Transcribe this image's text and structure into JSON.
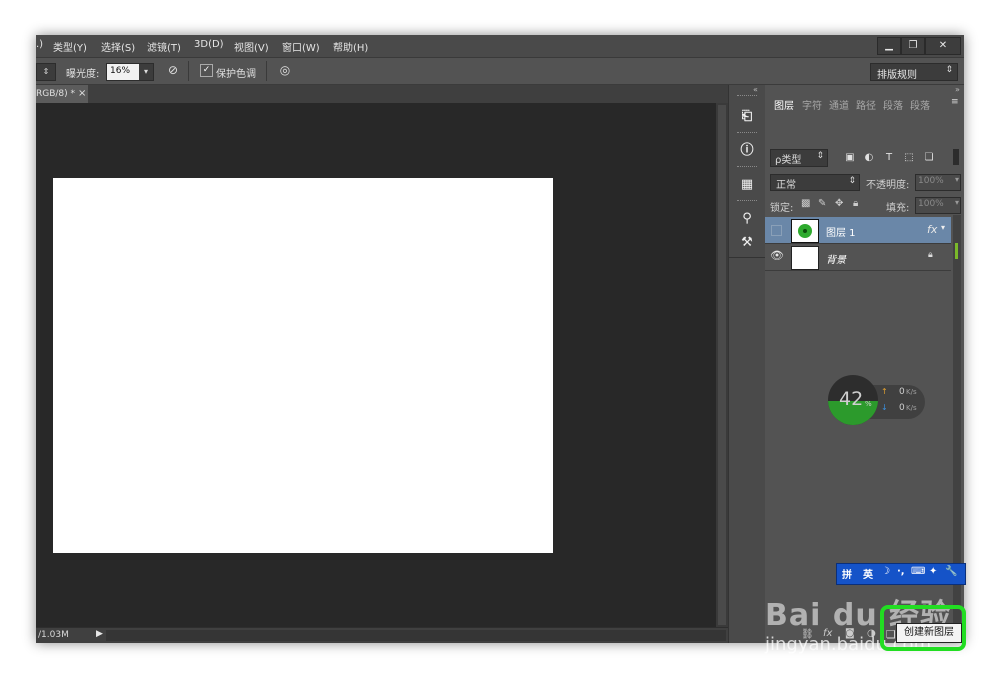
{
  "menu": {
    "items": [
      ".)",
      "类型(Y)",
      "选择(S)",
      "滤镜(T)",
      "3D(D)",
      "视图(V)",
      "窗口(W)",
      "帮助(H)"
    ]
  },
  "window_controls": {
    "minimize": "▁",
    "restore": "❐",
    "close": "✕"
  },
  "options": {
    "exposure_label": "曝光度:",
    "exposure_value": "16%",
    "protect_tone_label": "保护色调",
    "workspace": "排版规则"
  },
  "document": {
    "tab_label": "RGB/8) *",
    "tab_close": "×",
    "status_text": "/1.03M"
  },
  "layers_panel": {
    "tabs": [
      "图层",
      "字符",
      "通道",
      "路径",
      "段落",
      "段落"
    ],
    "filter_label": "ρ类型",
    "blend_mode": "正常",
    "opacity_label": "不透明度:",
    "opacity_value": "100%",
    "lock_label": "锁定:",
    "fill_label": "填充:",
    "fill_value": "100%",
    "layers": [
      {
        "name": "图层 1",
        "fx": "fx",
        "visible": false,
        "selected": true
      },
      {
        "name": "背景",
        "visible": true,
        "locked": true
      }
    ],
    "bottom_icons": [
      "link-icon",
      "fx-icon",
      "mask-icon",
      "adjustment-icon",
      "group-icon",
      "new-layer-icon",
      "trash-icon"
    ],
    "bottom_fx": "fx"
  },
  "net_monitor": {
    "percent": "42",
    "percent_unit": "%",
    "up_value": "0",
    "up_unit": "K/s",
    "down_value": "0",
    "down_unit": "K/s"
  },
  "ime_bar": {
    "items": [
      "拼",
      "英",
      "☽",
      "·,",
      "⌨",
      "✦",
      "🔧"
    ]
  },
  "tooltip": {
    "text": "创建新图层"
  },
  "watermark": {
    "logo": "Bai du 经验",
    "url": "jingyan.baidu.com"
  },
  "colors": {
    "highlight": "#22dd22",
    "selected_layer": "#6a87a8",
    "gauge_fill": "#2c9a2c"
  }
}
